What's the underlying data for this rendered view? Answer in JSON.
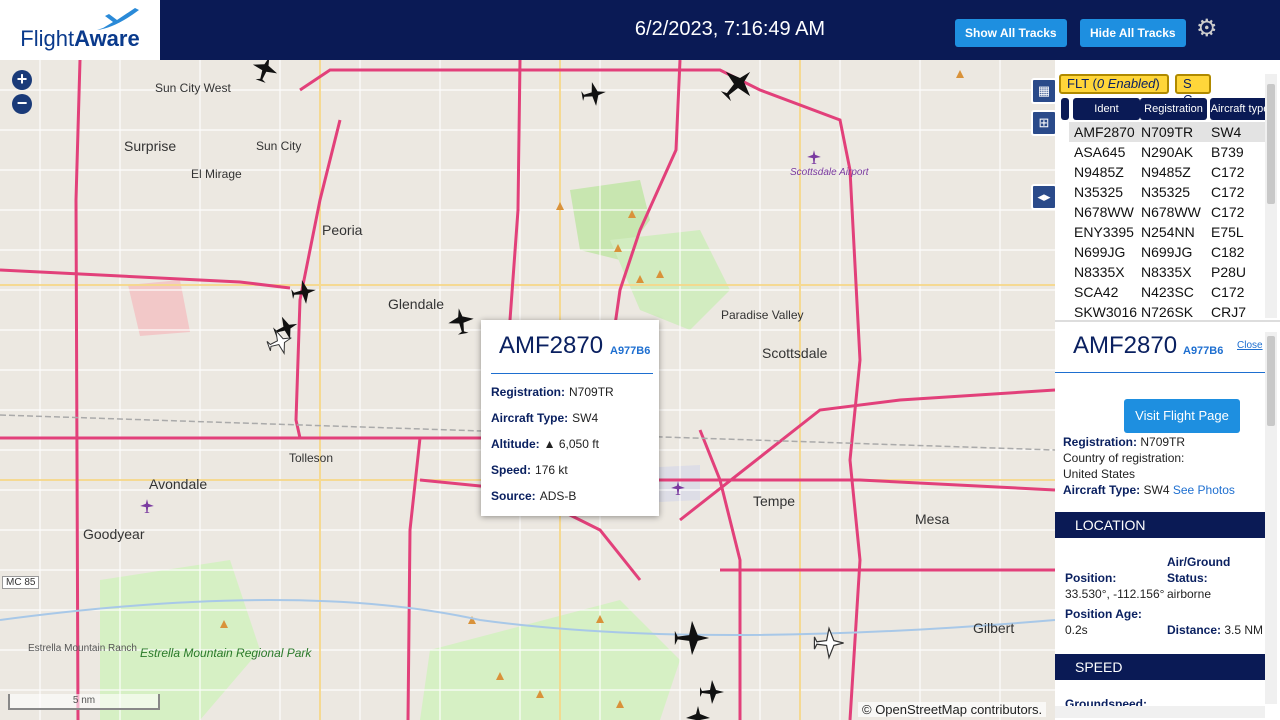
{
  "header": {
    "logo_text_light": "Flight",
    "logo_text_bold": "Aware",
    "timestamp": "6/2/2023, 7:16:49 AM",
    "show_tracks_label": "Show All Tracks",
    "hide_tracks_label": "Hide All Tracks",
    "settings_icon": "gear-icon",
    "colors": {
      "bar": "#0a1a55",
      "button": "#1e8fe0"
    }
  },
  "map": {
    "places": [
      {
        "name": "Sun City West"
      },
      {
        "name": "Surprise"
      },
      {
        "name": "Sun City"
      },
      {
        "name": "El Mirage"
      },
      {
        "name": "Peoria"
      },
      {
        "name": "Glendale"
      },
      {
        "name": "Paradise Valley"
      },
      {
        "name": "Scottsdale"
      },
      {
        "name": "Tolleson"
      },
      {
        "name": "Avondale"
      },
      {
        "name": "Goodyear"
      },
      {
        "name": "Tempe"
      },
      {
        "name": "Mesa"
      },
      {
        "name": "Gilbert"
      },
      {
        "name": "Estrella Mountain Ranch"
      },
      {
        "name": "Estrella Mountain Regional Park"
      },
      {
        "name": "Scottsdale Airport"
      }
    ],
    "scale_label": "5 nm",
    "attribution": "© OpenStreetMap contributors.",
    "route_label": "MC 85",
    "zoom_in": "+",
    "zoom_out": "−"
  },
  "popup": {
    "ident": "AMF2870",
    "hex": "A977B6",
    "registration_label": "Registration:",
    "registration": "N709TR",
    "aircraft_type_label": "Aircraft Type:",
    "aircraft_type": "SW4",
    "altitude_label": "Altitude:",
    "altitude": "▲ 6,050 ft",
    "speed_label": "Speed:",
    "speed": "176 kt",
    "source_label": "Source:",
    "source": "ADS-B"
  },
  "side": {
    "filter_label": "FLT (0 Enabled)",
    "filter_label_prefix": "FLT (",
    "filter_label_italic": "0 Enabled",
    "filter_label_suffix": ")",
    "sc_label": "S C",
    "columns": [
      "Ident",
      "Registration",
      "Aircraft type"
    ],
    "rows": [
      [
        "AMF2870",
        "N709TR",
        "SW4"
      ],
      [
        "ASA645",
        "N290AK",
        "B739"
      ],
      [
        "N9485Z",
        "N9485Z",
        "C172"
      ],
      [
        "N35325",
        "N35325",
        "C172"
      ],
      [
        "N678WW",
        "N678WW",
        "C172"
      ],
      [
        "ENY3395",
        "N254NN",
        "E75L"
      ],
      [
        "N699JG",
        "N699JG",
        "C182"
      ],
      [
        "N8335X",
        "N8335X",
        "P28U"
      ],
      [
        "SCA42",
        "N423SC",
        "C172"
      ],
      [
        "SKW3016",
        "N726SK",
        "CRJ7"
      ]
    ],
    "detail": {
      "ident": "AMF2870",
      "hex": "A977B6",
      "close_label": "Close",
      "visit_label": "Visit Flight Page",
      "registration_label": "Registration:",
      "registration": "N709TR",
      "country_label": "Country of registration:",
      "country": "United States",
      "aircraft_type_label": "Aircraft Type:",
      "aircraft_type": "SW4",
      "see_photos": "See Photos",
      "location_header": "LOCATION",
      "position_label": "Position:",
      "position": "33.530°, -112.156°",
      "airground_label": "Air/Ground Status:",
      "airground": "airborne",
      "position_age_label": "Position Age:",
      "position_age": "0.2s",
      "distance_label": "Distance:",
      "distance": "3.5 NM",
      "speed_header": "SPEED",
      "groundspeed_label": "Groundspeed:"
    }
  }
}
